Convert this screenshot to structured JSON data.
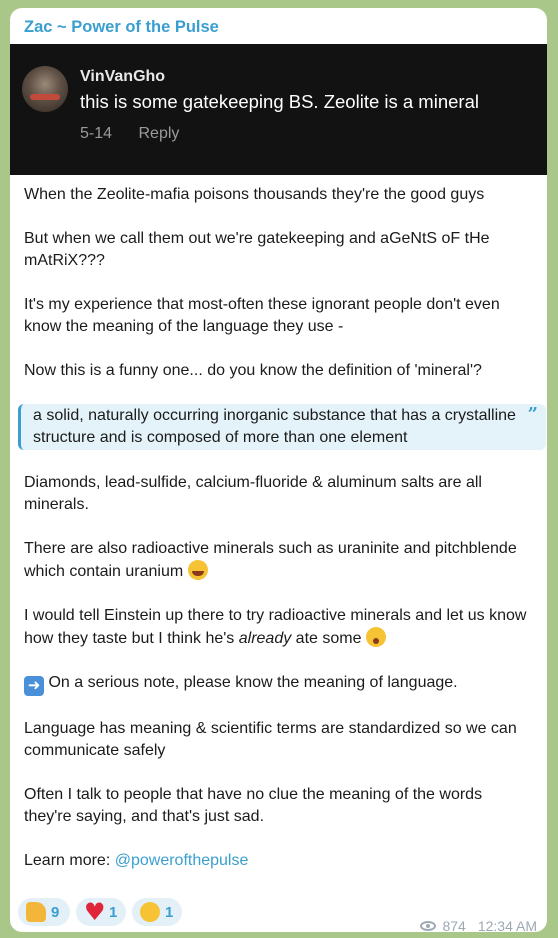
{
  "message": {
    "sender": "Zac ~ Power of the Pulse",
    "embedded": {
      "username": "VinVanGho",
      "comment": "this is some gatekeeping BS. Zeolite is a mineral",
      "date": "5-14",
      "reply_label": "Reply"
    },
    "paragraphs": [
      "When the Zeolite-mafia poisons thousands they're the good guys",
      "But when we call them out we're gatekeeping and aGeNtS oF tHe mAtRiX???",
      "It's my experience that most-often these ignorant people don't even know the meaning of the language they use -",
      "Now this is a funny one... do you know the definition of 'mineral'?"
    ],
    "quote": "a solid, naturally occurring inorganic substance that has a crystalline structure and is composed of more than one element",
    "paragraphs2": [
      "Diamonds, lead-sulfide, calcium-fluoride & aluminum salts are all minerals.",
      "There are also radioactive minerals such as uraninite and pitchblende which contain uranium"
    ],
    "einstein": {
      "before": "I would tell Einstein up there to try radioactive minerals and let us know how they taste but I think he's ",
      "italic": "already",
      "after": " ate some"
    },
    "serious_note": "On a serious note, please know the meaning of language.",
    "paragraphs3": [
      "Language has meaning & scientific terms are standardized so we can communicate safely",
      "Often I talk to people that have no clue the meaning of the words they're saying, and that's just sad."
    ],
    "learn_more": {
      "prefix": "Learn more: ",
      "link": "@powerofthepulse"
    }
  },
  "reactions": [
    {
      "icon": "thumbs-up-icon",
      "count": "9"
    },
    {
      "icon": "heart-icon",
      "count": "1"
    },
    {
      "icon": "thinking-face-icon",
      "count": "1"
    }
  ],
  "meta": {
    "views": "874",
    "time": "12:34 AM"
  },
  "colors": {
    "accent": "#3a9fd0",
    "background": "#a9c788",
    "quote_background": "#e4f3f9"
  }
}
